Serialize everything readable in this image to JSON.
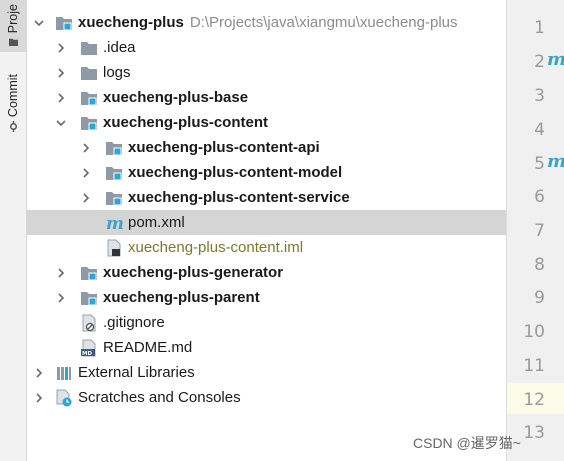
{
  "toolstrip": {
    "project_tab": "Proje",
    "commit_tab": "Commit"
  },
  "tree": {
    "root": {
      "label": "xuecheng-plus",
      "path": "D:\\Projects\\java\\xiangmu\\xuecheng-plus"
    },
    "idea": ".idea",
    "logs": "logs",
    "base": "xuecheng-plus-base",
    "content": "xuecheng-plus-content",
    "content_api": "xuecheng-plus-content-api",
    "content_model": "xuecheng-plus-content-model",
    "content_service": "xuecheng-plus-content-service",
    "pom": "pom.xml",
    "iml": "xuecheng-plus-content.iml",
    "generator": "xuecheng-plus-generator",
    "parent": "xuecheng-plus-parent",
    "gitignore": ".gitignore",
    "readme": "README.md",
    "external_libraries": "External Libraries",
    "scratches": "Scratches and Consoles"
  },
  "gutter": {
    "line_numbers": [
      "1",
      "2",
      "3",
      "4",
      "5",
      "6",
      "7",
      "8",
      "9",
      "10",
      "11",
      "12",
      "13"
    ],
    "marker_symbol": "m",
    "current_line": "12"
  },
  "watermark": "CSDN @暹罗猫~",
  "colors": {
    "folder_icon": "#8e9aa5",
    "module_badge": "#2aa7d6",
    "maven_icon": "#3fa3c7",
    "selection": "#d5d5d5",
    "iml_text": "#7a7a2a"
  }
}
